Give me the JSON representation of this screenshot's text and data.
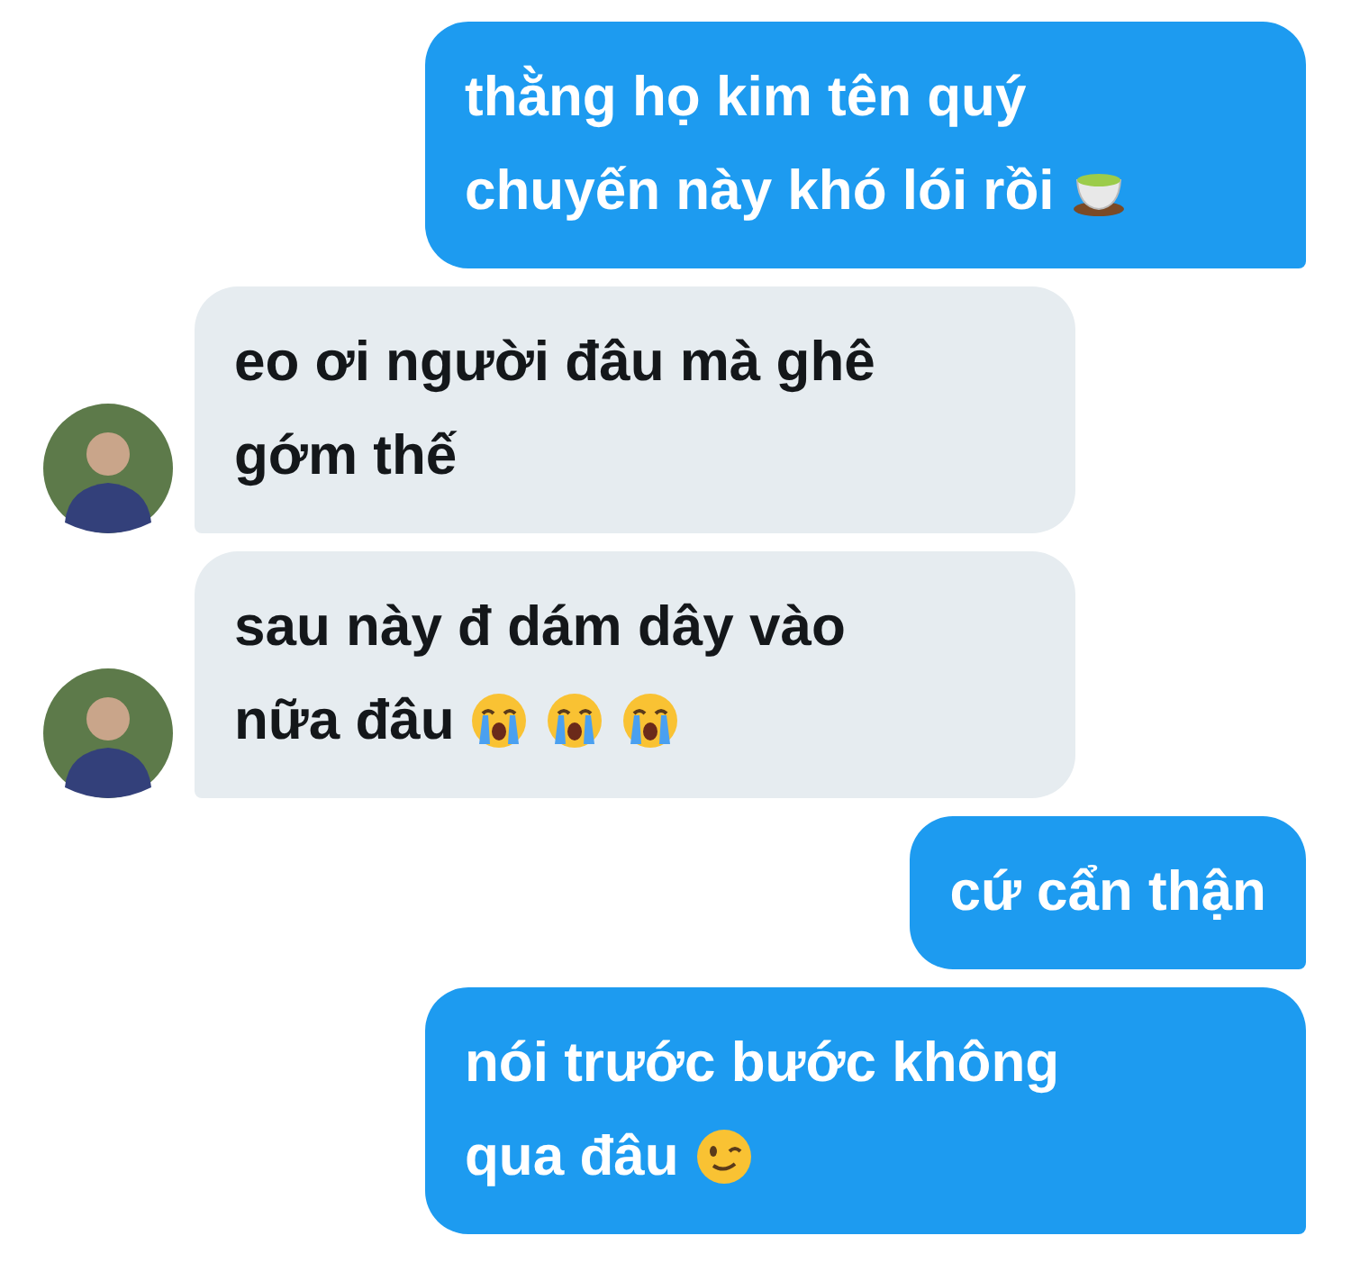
{
  "messages": [
    {
      "kind": "outgoing",
      "lines": [
        "thằng họ kim tên quý",
        "chuyến này khó lói rồi"
      ],
      "emojis": [
        {
          "kind": "teacup"
        }
      ]
    },
    {
      "kind": "incoming",
      "lines": [
        "eo ơi người đâu mà ghê",
        "gớm thế"
      ]
    },
    {
      "kind": "incoming",
      "lines": [
        "sau này đ dám dây vào",
        "nữa đâu"
      ],
      "emojis": [
        {
          "kind": "crying"
        },
        {
          "kind": "crying"
        },
        {
          "kind": "crying"
        }
      ]
    },
    {
      "kind": "outgoing",
      "lines": [
        "cứ cẩn thận"
      ]
    },
    {
      "kind": "outgoing",
      "lines": [
        "nói trước bước không",
        "qua đâu"
      ],
      "emojis": [
        {
          "kind": "winking"
        }
      ]
    }
  ]
}
